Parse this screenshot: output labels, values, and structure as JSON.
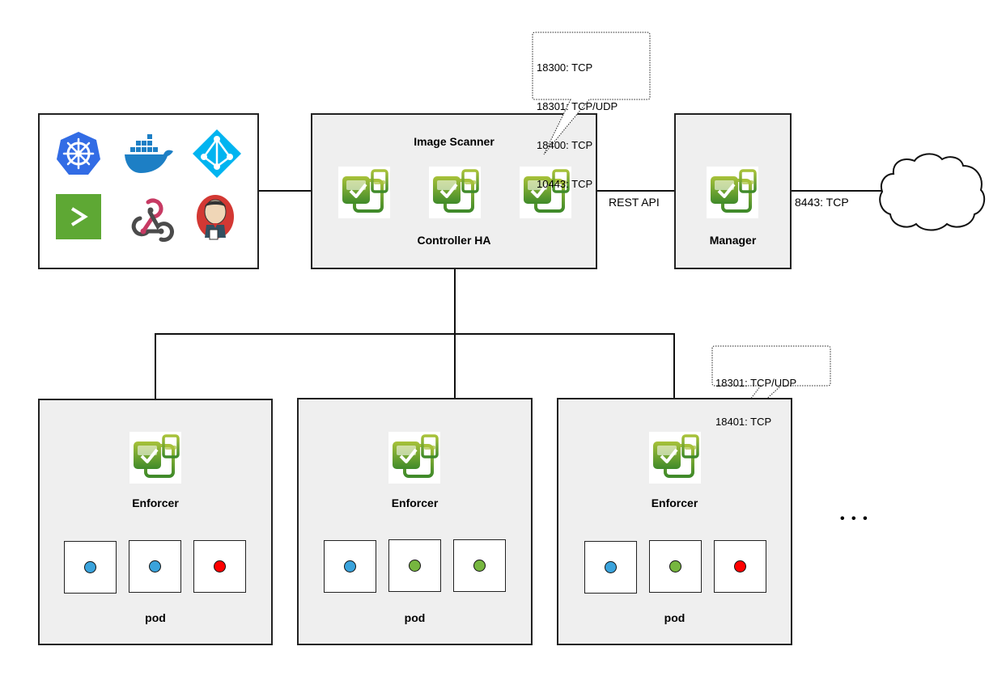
{
  "integrations_box": {
    "icons": [
      {
        "name": "kubernetes-icon",
        "color": "#326ce5"
      },
      {
        "name": "docker-icon",
        "color": "#1d7fc5"
      },
      {
        "name": "azure-ad-icon",
        "color": "#00b4f0"
      },
      {
        "name": "terminal-icon",
        "color": "#5ea834"
      },
      {
        "name": "webhook-icon",
        "color": "#c73a63"
      },
      {
        "name": "jenkins-icon",
        "color": "#d33833"
      }
    ]
  },
  "controller_box": {
    "top_label": "Image Scanner",
    "bottom_label": "Controller HA",
    "instance_count": 3
  },
  "controller_ports_callout": {
    "lines": [
      "18300: TCP",
      "18301: TCP/UDP",
      "18400: TCP",
      "10443: TCP"
    ]
  },
  "rest_api_label": "REST API",
  "manager_box": {
    "label": "Manager"
  },
  "manager_port_label": "8443: TCP",
  "cloud": {
    "name": "internet-cloud"
  },
  "enforcer_ports_callout": {
    "lines": [
      "18301: TCP/UDP",
      "18401: TCP"
    ]
  },
  "enforcers": [
    {
      "label": "Enforcer",
      "pod_label": "pod",
      "pods": [
        {
          "color": "#3aa3dc"
        },
        {
          "color": "#3aa3dc"
        },
        {
          "color": "#ff0000"
        }
      ]
    },
    {
      "label": "Enforcer",
      "pod_label": "pod",
      "pods": [
        {
          "color": "#3aa3dc"
        },
        {
          "color": "#76b63f"
        },
        {
          "color": "#76b63f"
        }
      ]
    },
    {
      "label": "Enforcer",
      "pod_label": "pod",
      "pods": [
        {
          "color": "#3aa3dc"
        },
        {
          "color": "#76b63f"
        },
        {
          "color": "#ff0000"
        }
      ]
    }
  ],
  "more_indicator": "• • •",
  "colors": {
    "box_fill": "#efefef",
    "border": "#222222",
    "nv_green_light": "#a8c23a",
    "nv_green_dark": "#3f8a2a"
  }
}
